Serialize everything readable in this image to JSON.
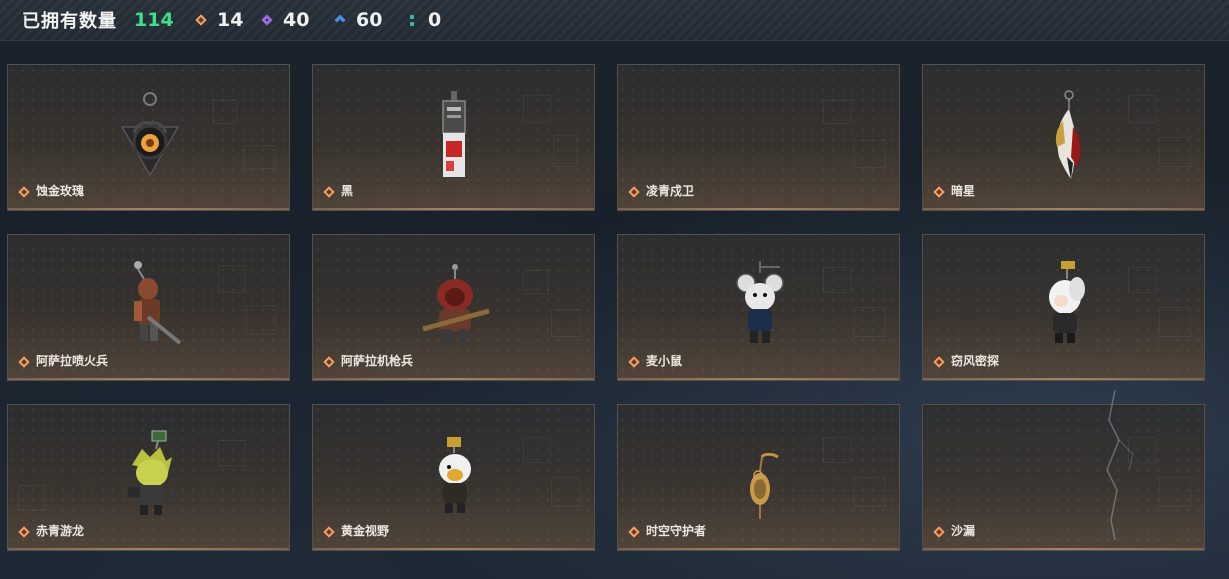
{
  "header": {
    "owned_label": "已拥有数量",
    "owned_count": "114",
    "stats": [
      {
        "icon": "orange-diamond-icon",
        "value": "14",
        "color": "#d0783c"
      },
      {
        "icon": "purple-diamond-icon",
        "value": "40",
        "color": "#9a6ad8"
      },
      {
        "icon": "blue-chevron-icon",
        "value": "60",
        "color": "#4c8ee0"
      },
      {
        "icon": "teal-dots-icon",
        "value": "0",
        "color": "#3fb7a8"
      }
    ]
  },
  "items": [
    {
      "label": "蚀金玫瑰",
      "art": "rose-pendant-icon"
    },
    {
      "label": "黑",
      "art": "tag-pendant-icon"
    },
    {
      "label": "凌青戍卫",
      "art": ""
    },
    {
      "label": "暗星",
      "art": "feather-pendant-icon"
    },
    {
      "label": "阿萨拉喷火兵",
      "art": "flamethrower-soldier-icon"
    },
    {
      "label": "阿萨拉机枪兵",
      "art": "machinegunner-icon"
    },
    {
      "label": "麦小鼠",
      "art": "mouse-figure-icon"
    },
    {
      "label": "窃风密探",
      "art": "white-hair-figure-icon"
    },
    {
      "label": "赤青游龙",
      "art": "dragon-figure-icon"
    },
    {
      "label": "黄金视野",
      "art": "golden-hair-figure-icon"
    },
    {
      "label": "时空守护者",
      "art": "clock-pendant-icon"
    },
    {
      "label": "沙漏",
      "art": ""
    }
  ],
  "colors": {
    "accent_green": "#3ee08a",
    "card_border": "#55504a",
    "rarity_orange": "#d0783c"
  }
}
